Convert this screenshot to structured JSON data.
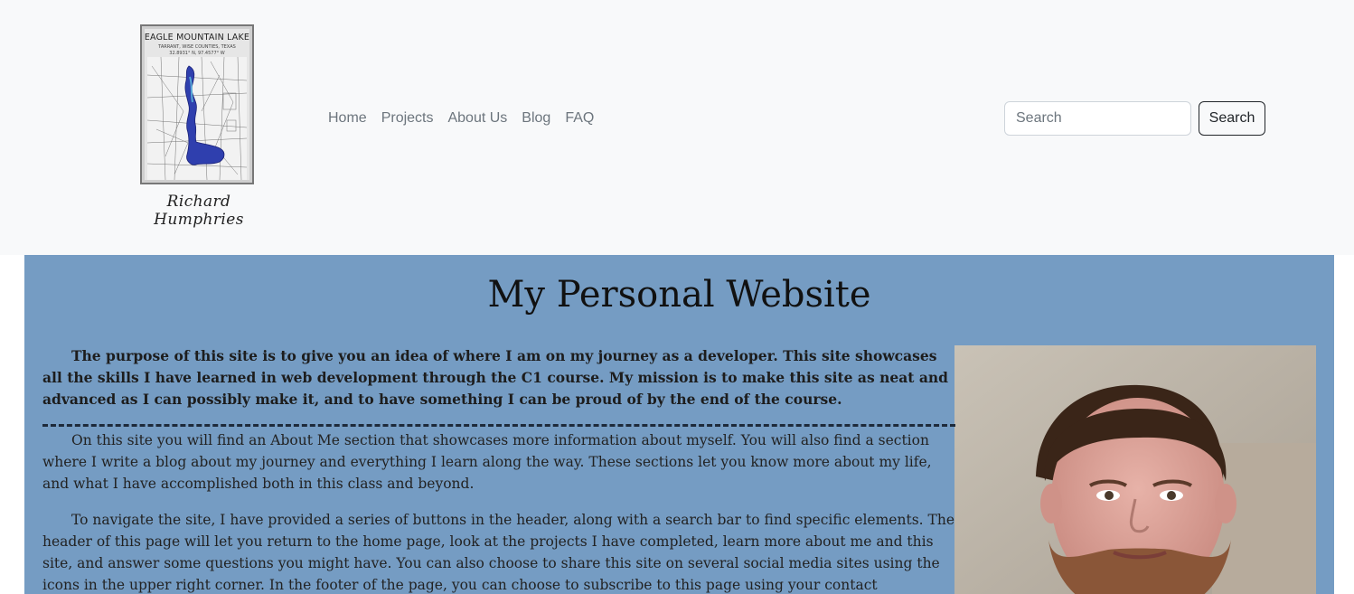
{
  "header": {
    "poster": {
      "title": "EAGLE MOUNTAIN LAKE",
      "subtitle": "TARRANT, WISE COUNTIES, TEXAS",
      "coords": "32.8931° N, 97.4577° W"
    },
    "signature": "Richard Humphries",
    "nav": [
      "Home",
      "Projects",
      "About Us",
      "Blog",
      "FAQ"
    ],
    "search": {
      "placeholder": "Search",
      "button_label": "Search"
    }
  },
  "main": {
    "title": "My Personal Website",
    "intro": "The purpose of this site is to give you an idea of where I am on my journey as a developer. This site showcases all the skills I have learned in web development through the C1 course. My mission is to make this site as neat and advanced as I can possibly make it, and to have something I can be proud of by the end of the course.",
    "paragraphs": [
      "On this site you will find an About Me section that showcases more information about myself. You will also find a section where I write a blog about my journey and everything I learn along the way. These sections let you know more about my life, and what I have accomplished both in this class and beyond.",
      "To navigate the site, I have provided a series of buttons in the header, along with a search bar to find specific elements. The header of this page will let you return to the home page, look at the projects I have completed, learn more about me and this site, and answer some questions you might have. You can also choose to share this site on several social media sites using the icons in the upper right corner. In the footer of the page, you can choose to subscribe to this page using your contact information."
    ]
  },
  "colors": {
    "header_bg": "#f8f9fa",
    "main_bg": "#759cc3",
    "nav_link": "#6c757d",
    "lake_blue": "#2f3fae"
  }
}
